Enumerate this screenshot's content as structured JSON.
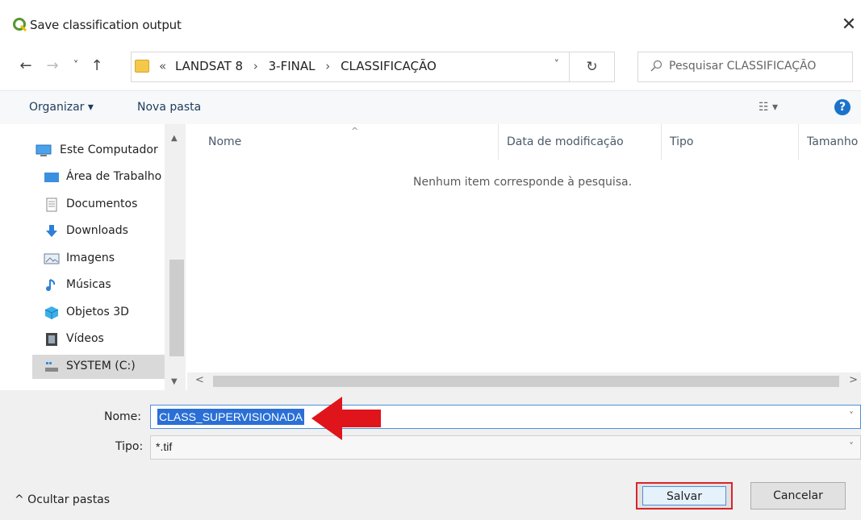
{
  "window": {
    "title": "Save classification output",
    "close_glyph": "✕",
    "logo_icon": "qgis-logo-icon"
  },
  "navigation": {
    "back_glyph": "←",
    "forward_glyph": "→",
    "recent_glyph": "˅",
    "up_glyph": "↑",
    "overflow_glyph": "«",
    "breadcrumbs": [
      "LANDSAT 8",
      "3-FINAL",
      "CLASSIFICAÇÃO"
    ],
    "separator": "›",
    "dropdown_glyph": "˅",
    "refresh_glyph": "↻",
    "search_placeholder": "Pesquisar CLASSIFICAÇÃO"
  },
  "toolbar": {
    "organize_label": "Organizar ▾",
    "new_folder_label": "Nova pasta",
    "view_glyph": "☷ ▾",
    "help_glyph": "?"
  },
  "sidebar": {
    "items": [
      {
        "label": "Este Computador",
        "icon": "computer-icon"
      },
      {
        "label": "Área de Trabalho",
        "icon": "desktop-icon"
      },
      {
        "label": "Documentos",
        "icon": "documents-icon"
      },
      {
        "label": "Downloads",
        "icon": "downloads-icon"
      },
      {
        "label": "Imagens",
        "icon": "pictures-icon"
      },
      {
        "label": "Músicas",
        "icon": "music-icon"
      },
      {
        "label": "Objetos 3D",
        "icon": "3d-objects-icon"
      },
      {
        "label": "Vídeos",
        "icon": "videos-icon"
      },
      {
        "label": "SYSTEM (C:)",
        "icon": "drive-icon",
        "selected": true
      }
    ],
    "scroll_up": "▲",
    "scroll_down": "▼"
  },
  "file_list": {
    "columns": [
      "Nome",
      "Data de modificação",
      "Tipo",
      "Tamanho"
    ],
    "sort_caret": "^",
    "empty_message": "Nenhum item corresponde à pesquisa.",
    "scroll_left": "<",
    "scroll_right": ">"
  },
  "form": {
    "name_label": "Nome:",
    "name_value": "CLASS_SUPERVISIONADA",
    "type_label": "Tipo:",
    "type_value": "*.tif",
    "dropdown_glyph": "˅"
  },
  "footer": {
    "hide_folders_label": "^  Ocultar pastas",
    "save_label": "Salvar",
    "cancel_label": "Cancelar"
  },
  "annotations": {
    "highlight_color": "#d9252a"
  }
}
